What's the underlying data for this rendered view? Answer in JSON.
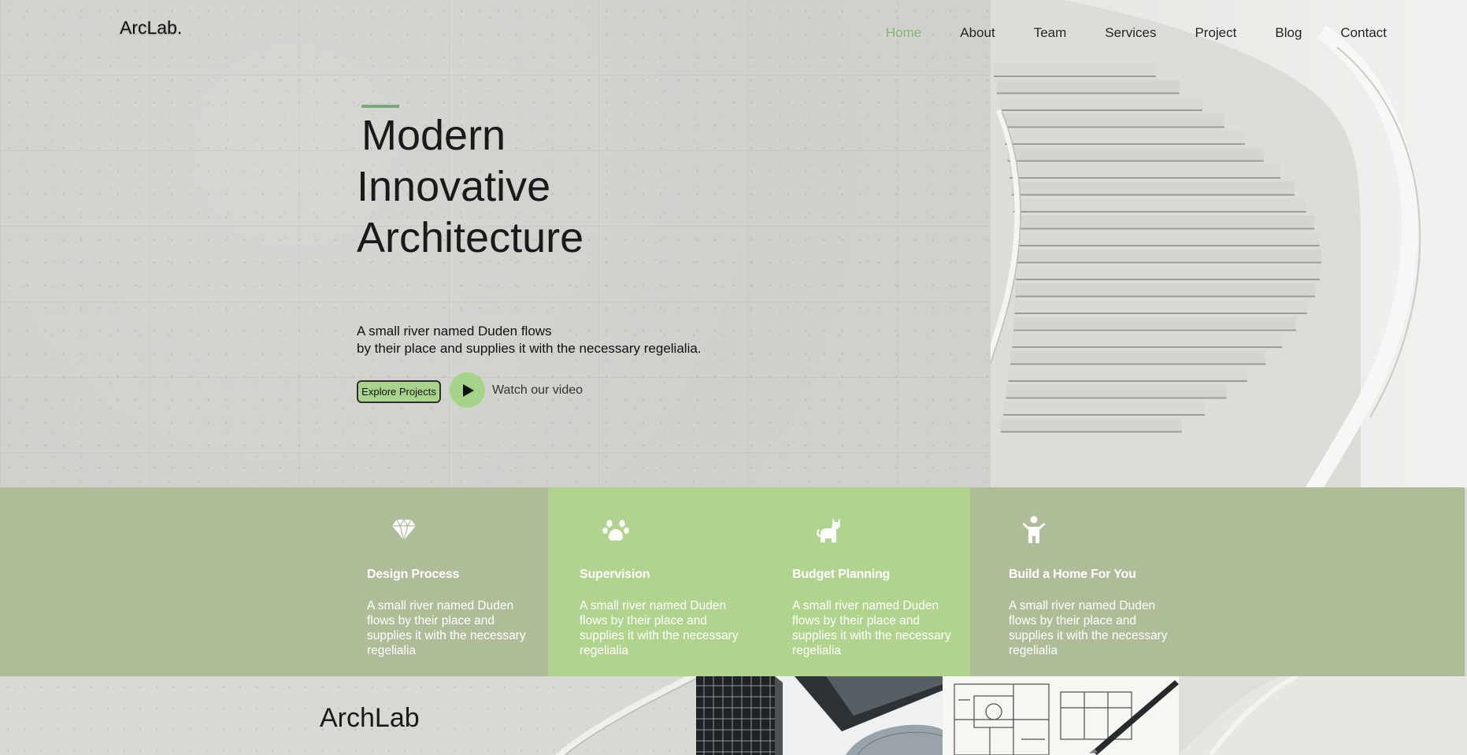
{
  "brand": {
    "logo": "ArcLab."
  },
  "nav": {
    "items": [
      {
        "label": "Home",
        "active": true
      },
      {
        "label": "About",
        "active": false
      },
      {
        "label": "Team",
        "active": false
      },
      {
        "label": "Services",
        "active": false
      },
      {
        "label": "Project",
        "active": false
      },
      {
        "label": "Blog",
        "active": false
      },
      {
        "label": "Contact",
        "active": false
      }
    ]
  },
  "hero": {
    "title_lines": [
      "Modern",
      "Innovative",
      "Architecture"
    ],
    "description_lines": [
      "A small river named Duden flows",
      "by their place and supplies it with the necessary regelialia."
    ],
    "explore_button": "Explore Projects",
    "watch_label": "Watch our video"
  },
  "services": [
    {
      "icon": "diamond-icon",
      "title": "Design Process",
      "description": "A small river named Duden flows by their place and supplies it with the necessary regelialia",
      "highlighted": false
    },
    {
      "icon": "paw-icon",
      "title": "Supervision",
      "description": "A small river named Duden flows by their place and supplies it with the necessary regelialia",
      "highlighted": true
    },
    {
      "icon": "cat-icon",
      "title": "Budget Planning",
      "description": "A small river named Duden flows by their place and supplies it with the necessary regelialia",
      "highlighted": true
    },
    {
      "icon": "child-icon",
      "title": "Build a Home For You",
      "description": "A small river named Duden flows by their place and supplies it with the necessary regelialia",
      "highlighted": false
    }
  ],
  "bottom": {
    "heading": "ArchLab"
  },
  "colors": {
    "accent_green": "#7fb36a",
    "service_band": "#aebd97",
    "service_highlight": "#b0d48e",
    "button_green": "#a9d38a"
  }
}
